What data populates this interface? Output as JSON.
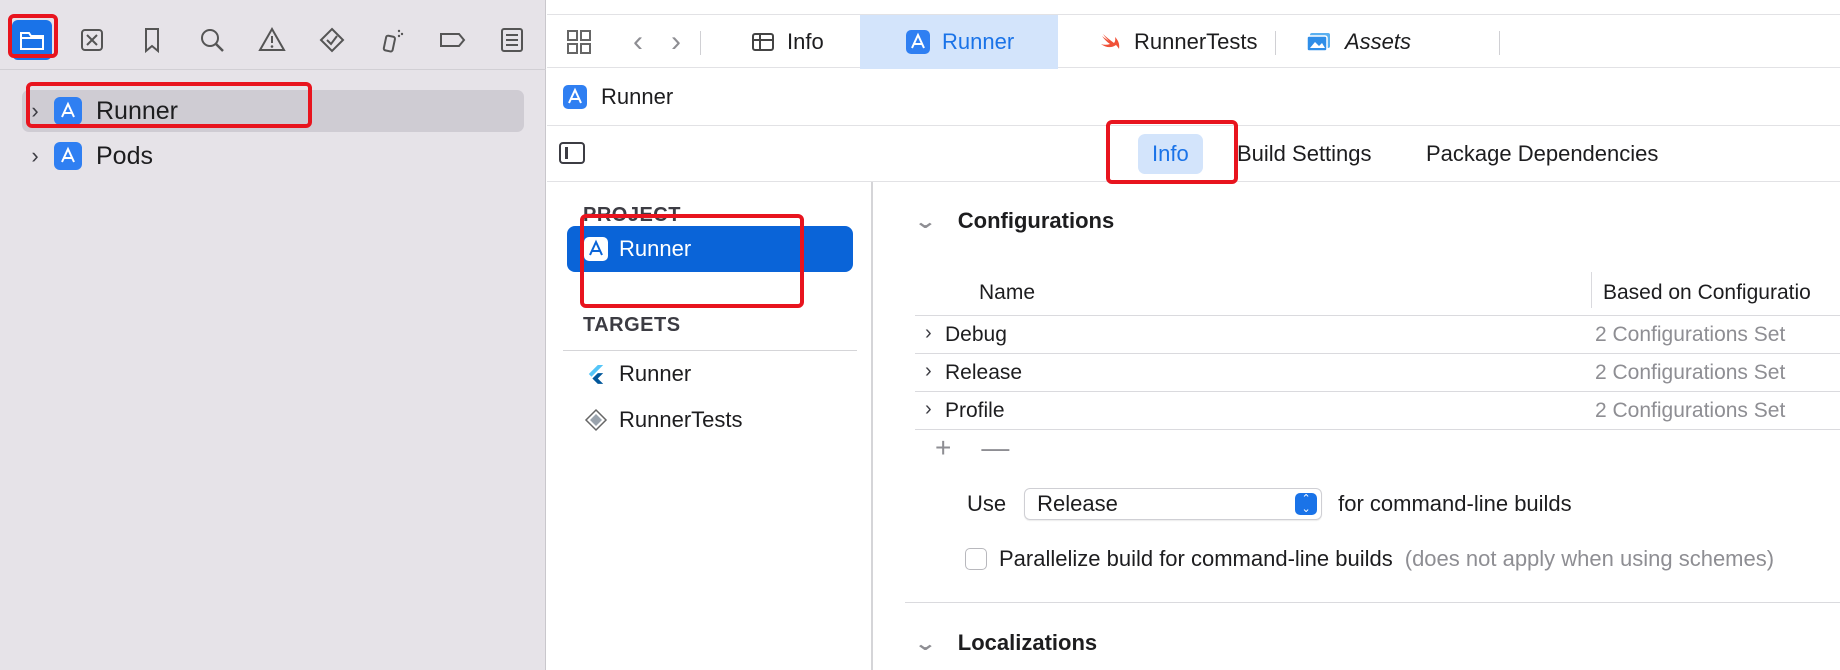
{
  "navigator": {
    "tools": [
      {
        "name": "folder-icon",
        "active": true
      },
      {
        "name": "source-control-icon"
      },
      {
        "name": "bookmark-icon"
      },
      {
        "name": "search-icon"
      },
      {
        "name": "warning-icon"
      },
      {
        "name": "test-diamond-icon"
      },
      {
        "name": "debug-spray-icon"
      },
      {
        "name": "breakpoint-icon"
      },
      {
        "name": "report-icon"
      }
    ],
    "tree": [
      {
        "label": "Runner",
        "selected": true
      },
      {
        "label": "Pods"
      }
    ]
  },
  "tabbar": {
    "tabs": [
      {
        "label": "Info",
        "icon": "table-icon"
      },
      {
        "label": "Runner",
        "icon": "xcode-project-icon",
        "active": true
      },
      {
        "label": "RunnerTests",
        "icon": "swift-icon"
      },
      {
        "label": "Assets",
        "icon": "asset-catalog-icon"
      }
    ]
  },
  "jumpbar": {
    "label": "Runner"
  },
  "segments": {
    "info": "Info",
    "build_settings": "Build Settings",
    "package_dependencies": "Package Dependencies"
  },
  "project_list": {
    "project_header": "PROJECT",
    "project_item": "Runner",
    "targets_header": "TARGETS",
    "targets": [
      {
        "label": "Runner",
        "icon": "flutter-icon"
      },
      {
        "label": "RunnerTests",
        "icon": "test-target-icon"
      }
    ]
  },
  "configurations": {
    "title": "Configurations",
    "col_name": "Name",
    "col_based_on": "Based on Configuratio",
    "rows": [
      {
        "name": "Debug",
        "value": "2 Configurations Set"
      },
      {
        "name": "Release",
        "value": "2 Configurations Set"
      },
      {
        "name": "Profile",
        "value": "2 Configurations Set"
      }
    ],
    "add_symbol": "+",
    "remove_symbol": "—",
    "use_label": "Use",
    "use_value": "Release",
    "use_suffix": "for command-line builds",
    "parallelize_label": "Parallelize build for command-line builds",
    "parallelize_note": "(does not apply when using schemes)",
    "parallelize_checked": false
  },
  "localizations": {
    "title": "Localizations"
  },
  "colors": {
    "accent": "#1a73e8",
    "selection": "#0a64d8",
    "highlight": "#e8141e"
  }
}
